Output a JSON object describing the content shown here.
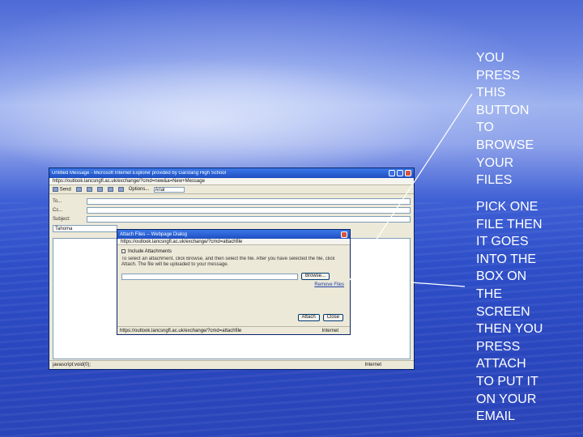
{
  "screenshot": {
    "window_title": "Untitled Message - Microsoft Internet Explorer provided by Garstang High School",
    "address": "https://outlook.lancsngfl.ac.uk/exchange/?cmd=new&a=New+Message",
    "toolbar": {
      "send_label": "Send",
      "options_label": "Options...",
      "font_select_value": "Arial"
    },
    "fields": {
      "to_label": "To...",
      "cc_label": "Cc...",
      "subject_label": "Subject:"
    },
    "format_select_value": "Tahoma",
    "status_text": "javascript:void(0);",
    "status_zone": "Internet"
  },
  "dialog": {
    "title": "Attach Files -- Webpage Dialog",
    "address": "https://outlook.lancsngfl.ac.uk/exchange/?cmd=attachfile",
    "include_label": "Include Attachments",
    "instructions": "To select an attachment, click Browse, and then select the file. After you have selected the file, click Attach. The file will be uploaded to your message.",
    "browse_label": "Browse...",
    "remove_label": "Remove Files",
    "attach_label": "Attach",
    "close_label": "Close",
    "status_text": "https://outlook.lancsngfl.ac.uk/exchange/?cmd=attachfile",
    "status_zone": "Internet"
  },
  "annotations": {
    "note1": [
      "YOU",
      "PRESS",
      "THIS",
      "BUTTON",
      "TO",
      "BROWSE",
      "YOUR",
      "FILES"
    ],
    "note2": [
      "PICK ONE",
      "FILE THEN",
      "IT GOES",
      "INTO THE",
      "BOX ON",
      "THE",
      "SCREEN",
      "THEN YOU",
      "PRESS",
      "ATTACH",
      "TO PUT IT",
      "ON YOUR",
      "EMAIL"
    ]
  },
  "colors": {
    "annotation_text": "#ffffff",
    "window_titlebar": "#1f4fc2",
    "window_face": "#ece9d8"
  }
}
